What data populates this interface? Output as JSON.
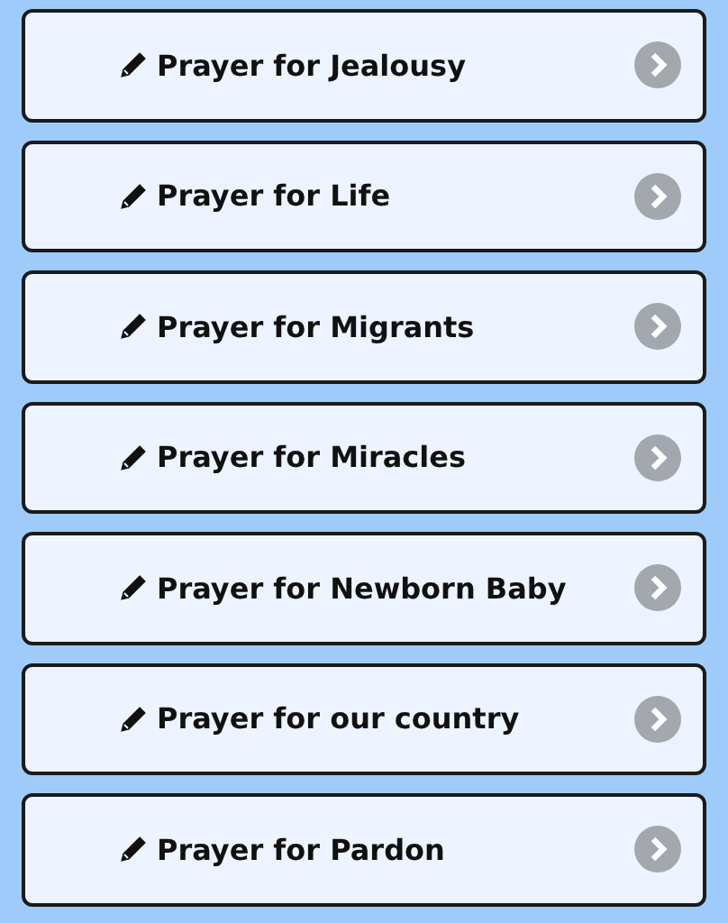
{
  "items": [
    {
      "title": "Prayer for Jealousy"
    },
    {
      "title": "Prayer for Life"
    },
    {
      "title": "Prayer for Migrants"
    },
    {
      "title": "Prayer for Miracles"
    },
    {
      "title": "Prayer for Newborn Baby"
    },
    {
      "title": "Prayer for our country"
    },
    {
      "title": "Prayer for Pardon"
    }
  ]
}
